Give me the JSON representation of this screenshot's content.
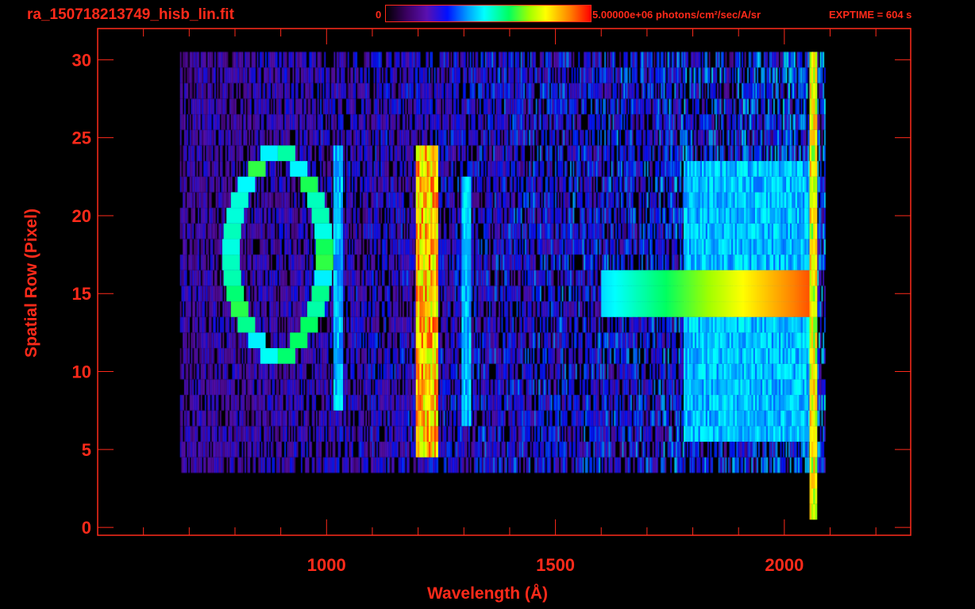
{
  "header": {
    "title": "ra_150718213749_hisb_lin.fit",
    "colorbar_min": "0",
    "colorbar_max": "5.00000e+06 photons/cm²/sec/A/sr",
    "exptime": "EXPTIME = 604 s"
  },
  "chart_data": {
    "type": "heatmap",
    "xlabel": "Wavelength (Å)",
    "ylabel": "Spatial Row (Pixel)",
    "xlim": [
      500,
      2276
    ],
    "ylim": [
      -0.5,
      32
    ],
    "xticks": [
      "1000",
      "1500",
      "2000"
    ],
    "yticks": [
      "0",
      "5",
      "10",
      "15",
      "20",
      "25",
      "30"
    ],
    "colormap": "rainbow (black-purple-blue-cyan-green-yellow-red)",
    "color_range": [
      0,
      5000000
    ],
    "axis_color": "#ff2a1a",
    "background": {
      "wavelength_range": [
        680,
        2090
      ],
      "rows": [
        4,
        30
      ],
      "level": 0.2
    },
    "features": [
      {
        "wavelength_range": [
          772,
          1015
        ],
        "rows": [
          11,
          24
        ],
        "level": 0.55,
        "shape": "ring"
      },
      {
        "wavelength_range": [
          1015,
          1035
        ],
        "rows": [
          8,
          24
        ],
        "level": 0.45,
        "shape": "band"
      },
      {
        "wavelength_range": [
          1195,
          1240
        ],
        "rows": [
          5,
          24
        ],
        "level": 0.88,
        "shape": "band"
      },
      {
        "wavelength_range": [
          1295,
          1315
        ],
        "rows": [
          7,
          22
        ],
        "level": 0.45,
        "shape": "band"
      },
      {
        "wavelength_range": [
          1780,
          2060
        ],
        "rows": [
          6,
          23
        ],
        "level": 0.45,
        "shape": "band"
      },
      {
        "wavelength_range": [
          1600,
          2065
        ],
        "rows": [
          14,
          16
        ],
        "level": 0.75,
        "shape": "band"
      },
      {
        "wavelength_range": [
          2055,
          2068
        ],
        "rows": [
          1,
          30
        ],
        "level": 0.8,
        "shape": "band"
      }
    ]
  }
}
